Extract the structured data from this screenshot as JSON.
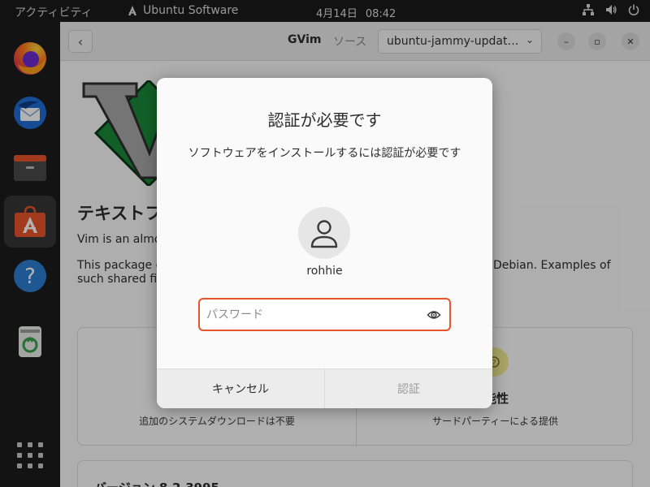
{
  "topbar": {
    "activities": "アクティビティ",
    "app_menu": "Ubuntu Software",
    "date": "4月14日",
    "time": "08:42"
  },
  "dock": {
    "items": [
      "Firefox",
      "Thunderbird",
      "Files",
      "Ubuntu Software",
      "Help",
      "Trash"
    ],
    "active": "Ubuntu Software"
  },
  "headerbar": {
    "title": "GVim",
    "source_label": "ソース",
    "source_value": "ubuntu-jammy-updat…"
  },
  "content": {
    "app_name": "テキストフ",
    "summary": "Vim is an almo",
    "desc_line1": "This package co",
    "desc_line2": "such shared file",
    "desc_right": "Debian.  Examples of",
    "tile_left_text": "追加のシステムダウンロードは不要",
    "tile_right_title": "い可能性",
    "tile_right_text": "サードパーティーによる提供",
    "version": "バージョン 8.2.3995"
  },
  "dialog": {
    "title": "認証が必要です",
    "message": "ソフトウェアをインストールするには認証が必要です",
    "username": "rohhie",
    "password_placeholder": "パスワード",
    "cancel_label": "キャンセル",
    "auth_label": "認証"
  },
  "colors": {
    "accent": "#e9542b",
    "topbar_bg": "#1a1a1a",
    "dialog_bg": "#fafafa"
  }
}
